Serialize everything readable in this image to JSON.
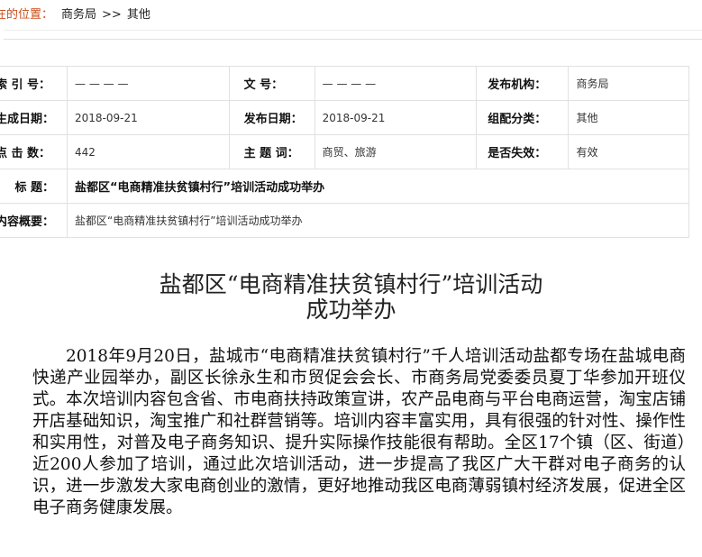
{
  "breadcrumb": {
    "label": "您现在的位置：",
    "visible_label": "在的位置：",
    "items": [
      "商务局",
      "其他"
    ],
    "separator": ">>"
  },
  "meta": {
    "row1": {
      "k1": "索 引 号：",
      "v1": "— — — —",
      "k2": "文      号：",
      "v2": "— — — —",
      "k3": "发布机构：",
      "v3": "商务局"
    },
    "row2": {
      "k1": "生成日期：",
      "v1": "2018-09-21",
      "k2": "发布日期：",
      "v2": "2018-09-21",
      "k3": "组配分类：",
      "v3": "其他"
    },
    "row3": {
      "k1": "点 击 数：",
      "v1": "442",
      "k2": "主 题 词：",
      "v2": "商贸、旅游",
      "k3": "是否失效：",
      "v3": "有效"
    },
    "row4": {
      "k": "标 题：",
      "v": "盐都区“电商精准扶贫镇村行”培训活动成功举办"
    },
    "row5": {
      "k": "内容概要：",
      "v": "盐都区“电商精准扶贫镇村行”培训活动成功举办"
    }
  },
  "article": {
    "title_line1": "盐都区“电商精准扶贫镇村行”培训活动",
    "title_line2": "成功举办",
    "body": "2018年9月20日，盐城市“电商精准扶贫镇村行”千人培训活动盐都专场在盐城电商快递产业园举办，副区长徐永生和市贸促会会长、市商务局党委委员夏丁华参加开班仪式。本次培训内容包含省、市电商扶持政策宣讲，农产品电商与平台电商运营，淘宝店铺开店基础知识，淘宝推广和社群营销等。培训内容丰富实用，具有很强的针对性、操作性和实用性，对普及电子商务知识、提升实际操作技能很有帮助。全区17个镇（区、街道）近200人参加了培训，通过此次培训活动，进一步提高了我区广大干群对电子商务的认识，进一步激发大家电商创业的激情，更好地推动我区电商薄弱镇村经济发展，促进全区电子商务健康发展。"
  }
}
